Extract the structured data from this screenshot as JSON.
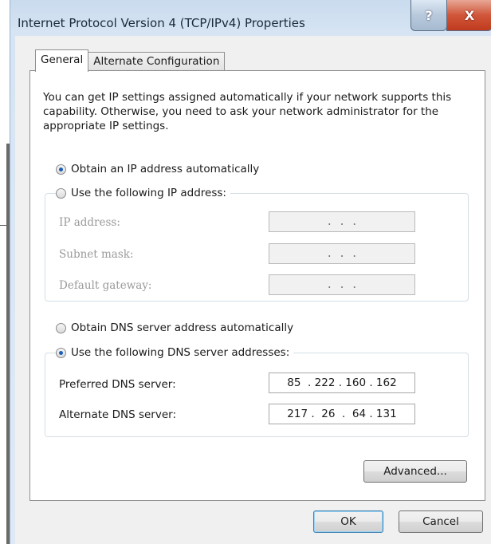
{
  "window": {
    "title": "Internet Protocol Version 4 (TCP/IPv4) Properties",
    "help_label": "?",
    "close_label": "X"
  },
  "tabs": [
    {
      "label": "General"
    },
    {
      "label": "Alternate Configuration"
    }
  ],
  "intro_text": "You can get IP settings assigned automatically if your network supports this capability. Otherwise, you need to ask your network administrator for the appropriate IP settings.",
  "ip": {
    "auto_label": "Obtain an IP address automatically",
    "manual_label": "Use the following IP address:",
    "auto_selected": true,
    "fields": [
      {
        "label": "IP address:",
        "value": ". . ."
      },
      {
        "label": "Subnet mask:",
        "value": ". . ."
      },
      {
        "label": "Default gateway:",
        "value": ". . ."
      }
    ]
  },
  "dns": {
    "auto_label": "Obtain DNS server address automatically",
    "manual_label": "Use the following DNS server addresses:",
    "manual_selected": true,
    "preferred": {
      "label": "Preferred DNS server:",
      "value": "85  . 222 . 160 . 162"
    },
    "alternate": {
      "label": "Alternate DNS server:",
      "value": "217 .  26  .  64 . 131"
    }
  },
  "buttons": {
    "advanced": "Advanced...",
    "ok": "OK",
    "cancel": "Cancel"
  }
}
